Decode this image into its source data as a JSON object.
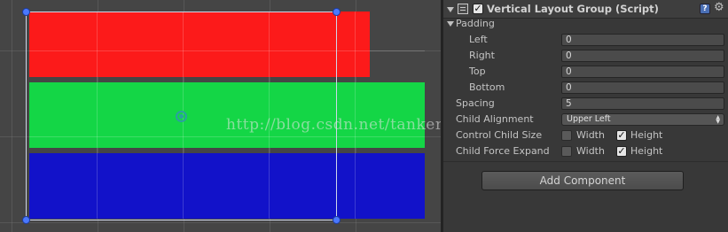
{
  "scene": {
    "watermark": "http://blog.csdn.net/tankerhunter",
    "colors": {
      "red": "#fc1a1a",
      "green": "#14d646",
      "blue": "#1212c9",
      "background": "#454545"
    }
  },
  "inspector": {
    "component_title": "Vertical Layout Group (Script)",
    "component_enabled": true,
    "help_icon_glyph": "?",
    "gear_icon_glyph": "⚙",
    "padding_label": "Padding",
    "padding": [
      {
        "label": "Left",
        "value": "0"
      },
      {
        "label": "Right",
        "value": "0"
      },
      {
        "label": "Top",
        "value": "0"
      },
      {
        "label": "Bottom",
        "value": "0"
      }
    ],
    "spacing": {
      "label": "Spacing",
      "value": "5"
    },
    "child_alignment": {
      "label": "Child Alignment",
      "value": "Upper Left"
    },
    "control_child_size": {
      "label": "Control Child Size",
      "width": {
        "label": "Width",
        "checked": false
      },
      "height": {
        "label": "Height",
        "checked": true
      }
    },
    "child_force_expand": {
      "label": "Child Force Expand",
      "width": {
        "label": "Width",
        "checked": false
      },
      "height": {
        "label": "Height",
        "checked": true
      }
    },
    "add_component_label": "Add Component"
  }
}
